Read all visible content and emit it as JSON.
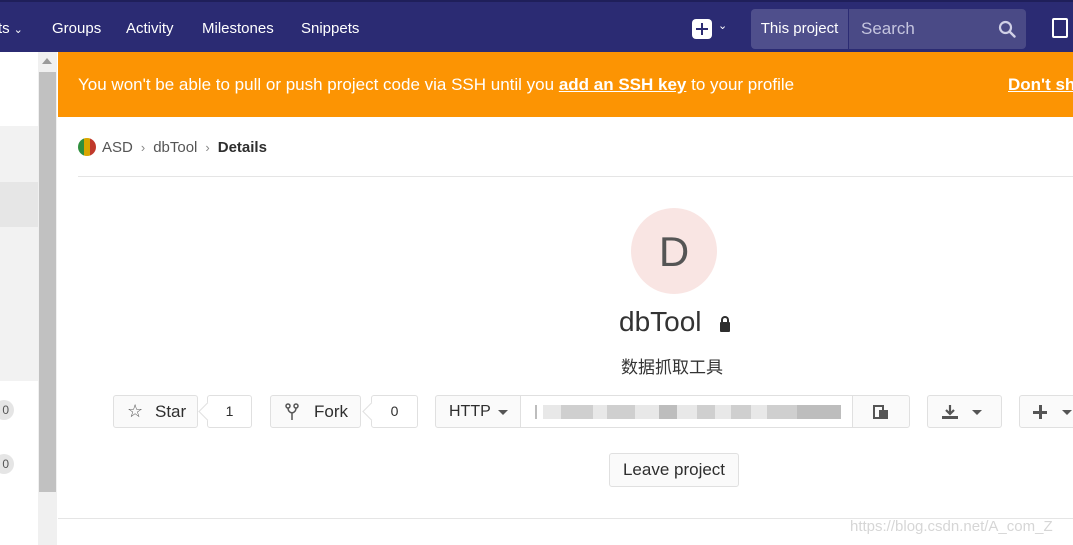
{
  "navbar": {
    "projects_label": "ts",
    "groups_label": "Groups",
    "activity_label": "Activity",
    "milestones_label": "Milestones",
    "snippets_label": "Snippets",
    "search_scope": "This project",
    "search_placeholder": "Search"
  },
  "sidebar": {
    "badge_1": "0",
    "badge_2": "0"
  },
  "alert": {
    "text_before": "You won't be able to pull or push project code via SSH until you ",
    "link_text": "add an SSH key",
    "text_after": " to your profile",
    "dismiss_label": "Don't sh"
  },
  "breadcrumb": {
    "group": "ASD",
    "project": "dbTool",
    "current": "Details"
  },
  "project": {
    "avatar_letter": "D",
    "name": "dbTool",
    "description": "数据抓取工具"
  },
  "controls": {
    "star_label": "Star",
    "star_count": "1",
    "fork_label": "Fork",
    "fork_count": "0",
    "protocol": "HTTP",
    "leave_label": "Leave project"
  },
  "watermark": "https://blog.csdn.net/A_com_Z"
}
